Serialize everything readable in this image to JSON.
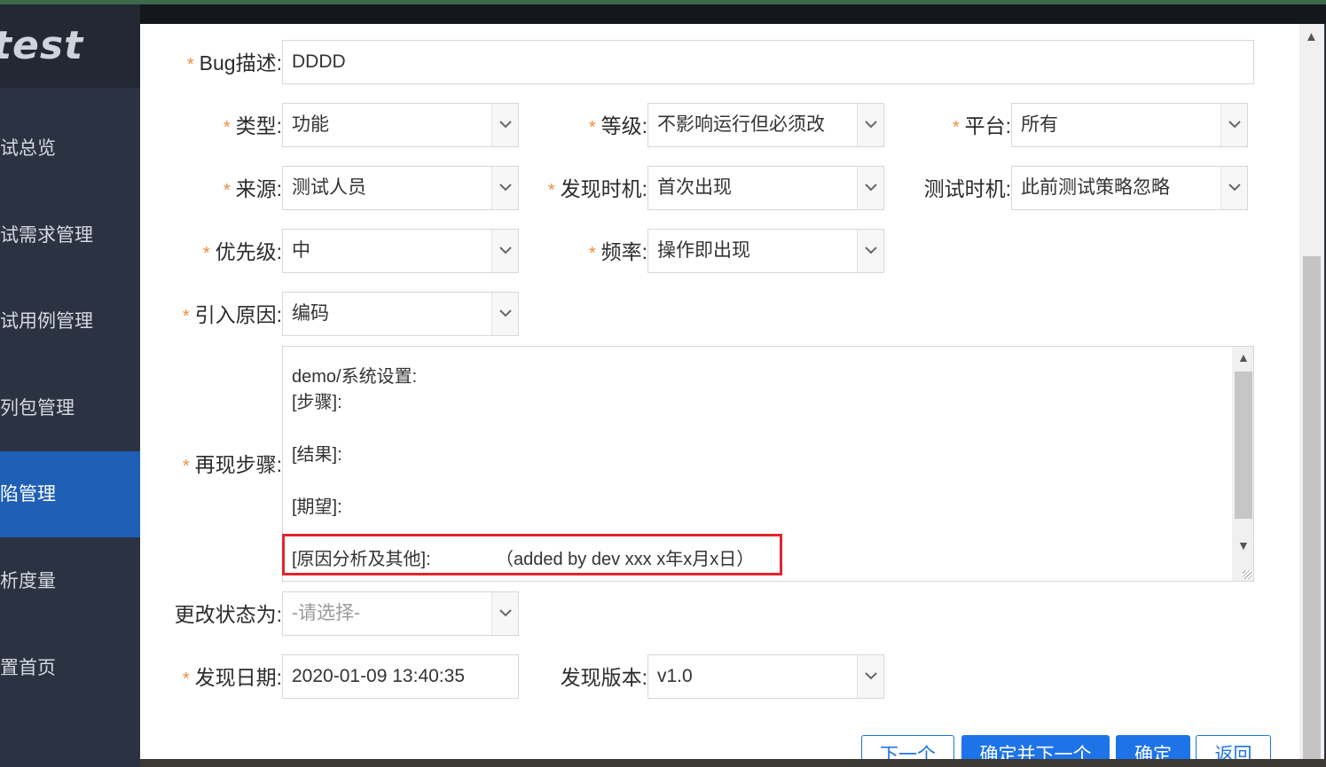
{
  "sidebar": {
    "logo": "test",
    "items": [
      {
        "label": "试总览",
        "active": false
      },
      {
        "label": "试需求管理",
        "active": false
      },
      {
        "label": "试用例管理",
        "active": false
      },
      {
        "label": "列包管理",
        "active": false
      },
      {
        "label": "陷管理",
        "active": true
      },
      {
        "label": "析度量",
        "active": false
      },
      {
        "label": "置首页",
        "active": false
      }
    ]
  },
  "form": {
    "bug_desc": {
      "label": "Bug描述:",
      "value": "DDDD"
    },
    "type": {
      "label": "类型:",
      "value": "功能"
    },
    "level": {
      "label": "等级:",
      "value": "不影响运行但必须改"
    },
    "platform": {
      "label": "平台:",
      "value": "所有"
    },
    "source": {
      "label": "来源:",
      "value": "测试人员"
    },
    "discover_timing": {
      "label": "发现时机:",
      "value": "首次出现"
    },
    "test_timing": {
      "label": "测试时机:",
      "value": "此前测试策略忽略"
    },
    "priority": {
      "label": "优先级:",
      "value": "中"
    },
    "frequency": {
      "label": "频率:",
      "value": "操作即出现"
    },
    "cause": {
      "label": "引入原因:",
      "value": "编码"
    },
    "repro": {
      "label": "再现步骤:",
      "lines": [
        "demo/系统设置:",
        "[步骤]:",
        "[结果]:",
        "[期望]:",
        "[原因分析及其他]:",
        "（added by dev xxx x年x月x日）"
      ]
    },
    "status": {
      "label": "更改状态为:",
      "placeholder": "-请选择-"
    },
    "discover_date": {
      "label": "发现日期:",
      "value": "2020-01-09 13:40:35"
    },
    "discover_version": {
      "label": "发现版本:",
      "value": "v1.0"
    }
  },
  "buttons": {
    "next": "下一个",
    "confirm_next": "确定并下一个",
    "confirm": "确定",
    "back": "返回"
  },
  "colors": {
    "accent": "#1e73e8",
    "required": "#f08c3c",
    "highlight": "#e3242b",
    "sidebar_active": "#1f5fb6"
  }
}
